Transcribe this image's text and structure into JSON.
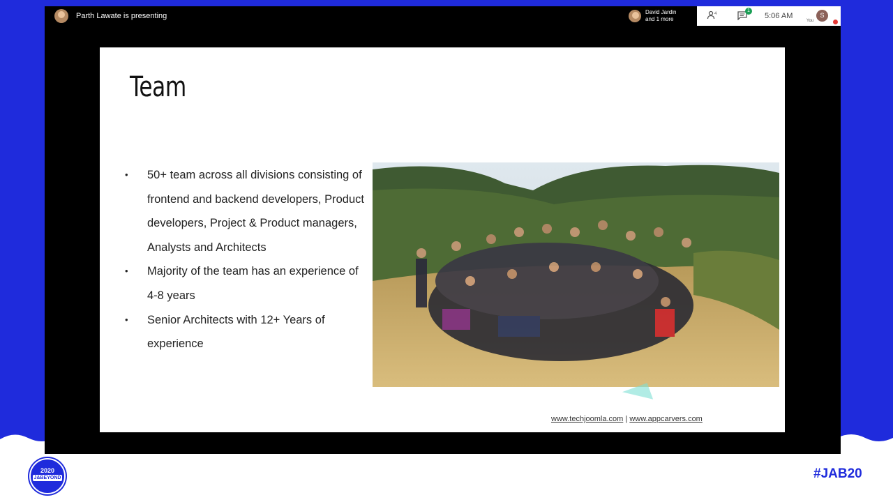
{
  "meeting": {
    "presenter_text": "Parth Lawate is presenting",
    "participants_line1": "David Jardin",
    "participants_line2": "and 1 more",
    "participants_count": "4",
    "chat_badge": "1",
    "time": "5:06 AM",
    "user_initial": "S",
    "user_label": "You"
  },
  "slide": {
    "title": "Team",
    "bullets": [
      "50+  team across all divisions consisting of frontend and backend developers, Product developers, Project & Product managers, Analysts and Architects",
      "Majority of the team has an experience of 4-8 years",
      "Senior Architects with 12+ Years of experience"
    ],
    "footer_link1": "www.techjoomla.com",
    "footer_sep": " | ",
    "footer_link2": "www.appcarvers.com"
  },
  "branding": {
    "logo_year": "2020",
    "logo_name": "J&BEYOND",
    "hashtag": "#JAB20",
    "accent": "#1f2bdc"
  }
}
